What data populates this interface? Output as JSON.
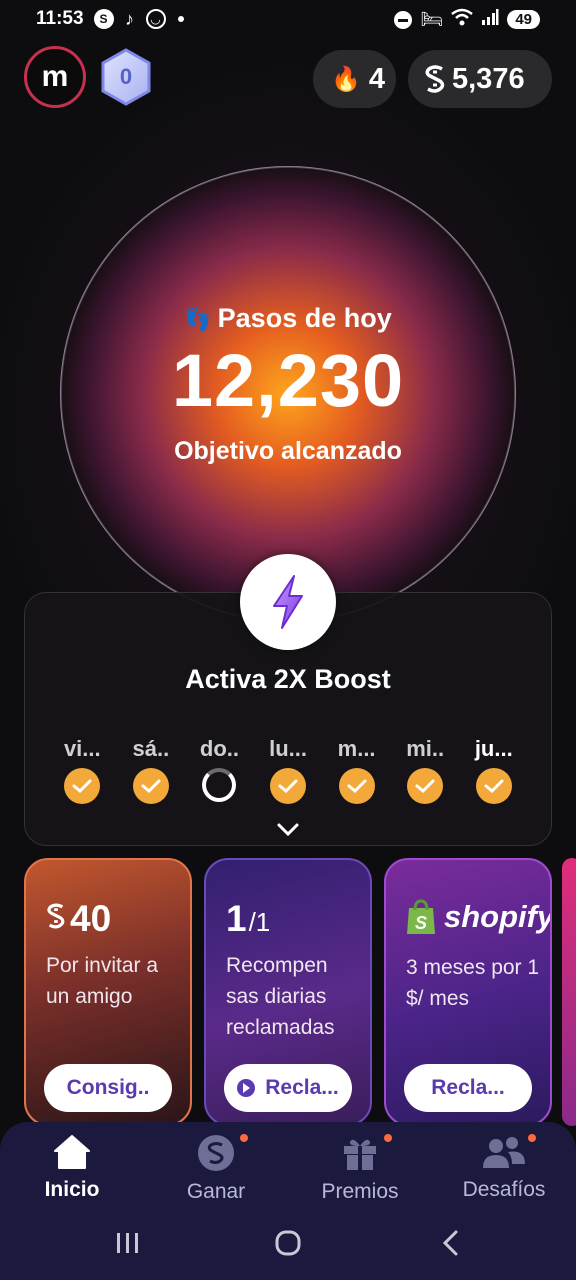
{
  "status_bar": {
    "time": "11:53",
    "battery": "49"
  },
  "profile": {
    "avatar_letter": "m",
    "level": "0"
  },
  "header": {
    "streak": "4",
    "coins": "5,376"
  },
  "steps": {
    "label": "Pasos de hoy",
    "value": "12,230",
    "goal_text": "Objetivo alcanzado"
  },
  "boost": {
    "title": "Activa 2X Boost",
    "days": [
      {
        "label": "vi...",
        "done": true
      },
      {
        "label": "sá..",
        "done": true
      },
      {
        "label": "do..",
        "done": false
      },
      {
        "label": "lu...",
        "done": true
      },
      {
        "label": "m...",
        "done": true
      },
      {
        "label": "mi..",
        "done": true
      },
      {
        "label": "ju...",
        "done": true
      }
    ]
  },
  "rewards": [
    {
      "value": "40",
      "desc": "Por invitar a un amigo",
      "button": "Consig.."
    },
    {
      "value": "1",
      "value_total": "/1",
      "desc": "Recompen sas diarias reclamadas",
      "button": "Recla..."
    },
    {
      "brand": "shopify",
      "desc": "3 meses por 1 $/ mes",
      "button": "Recla..."
    }
  ],
  "nav": {
    "home": "Inicio",
    "earn": "Ganar",
    "rewards": "Premios",
    "challenges": "Desafíos"
  }
}
